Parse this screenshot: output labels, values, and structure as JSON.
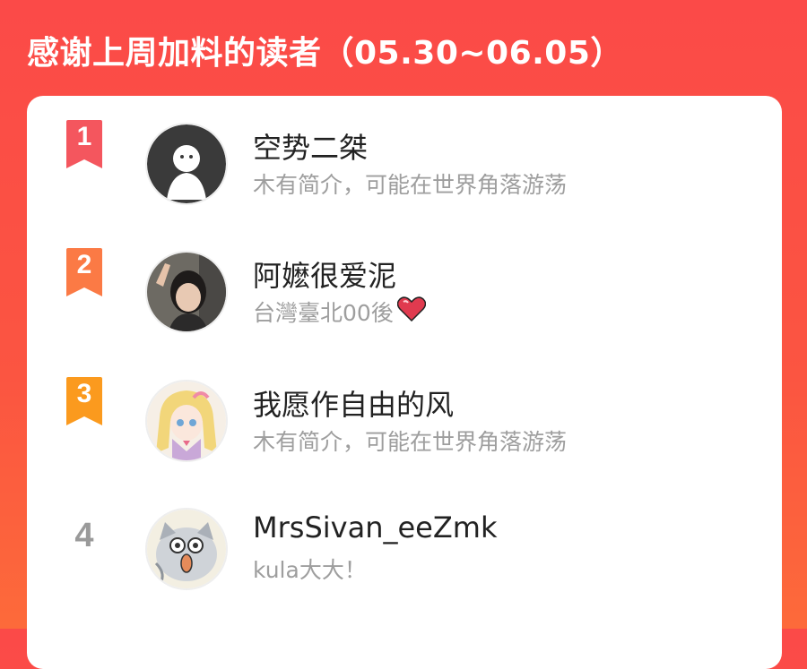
{
  "header": {
    "title": "感谢上周加料的读者（05.30~06.05）"
  },
  "colors": {
    "background": "#fb4a48",
    "rank1": "#f4565e",
    "rank2": "#fb7a45",
    "rank3": "#fb9a1e",
    "rank_plain": "#9a9a9a"
  },
  "readers": [
    {
      "rank": "1",
      "name": "空势二桀",
      "bio": "木有简介，可能在世界角落游荡",
      "avatar_icon": "default-ghost-avatar"
    },
    {
      "rank": "2",
      "name": "阿嬷很爱泥",
      "bio": "台灣臺北00後",
      "bio_emoji": "heart-icon",
      "avatar_icon": "photo-avatar"
    },
    {
      "rank": "3",
      "name": "我愿作自由的风",
      "bio": "木有简介，可能在世界角落游荡",
      "avatar_icon": "anime-girl-avatar"
    },
    {
      "rank": "4",
      "name": "MrsSivan_eeZmk",
      "bio": "kula大大！",
      "avatar_icon": "cartoon-cat-avatar"
    }
  ]
}
